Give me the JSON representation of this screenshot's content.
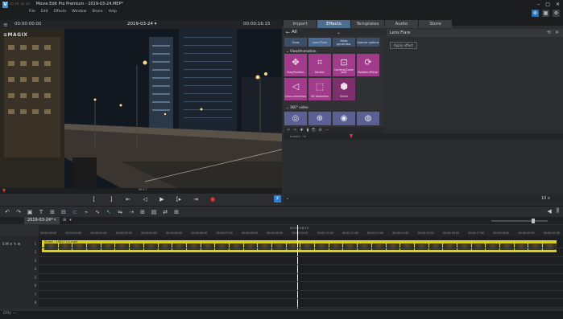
{
  "window": {
    "title": "Movie Edit Pro Premium - 2019-03-24.MEP*",
    "menu": [
      "File",
      "Edit",
      "Effects",
      "Window",
      "Share",
      "Help"
    ],
    "controls": [
      "–",
      "□",
      "✕"
    ]
  },
  "monitor": {
    "timecode_left": "00:00:00:00",
    "date": "2019-03-24 ▾",
    "timecode_right": "00:00:16:15",
    "logo": "≡MAGIX",
    "scrub_time": "06:17"
  },
  "panel_tabs": [
    {
      "label": "Import",
      "active": false
    },
    {
      "label": "Effects",
      "active": true
    },
    {
      "label": "Templates",
      "active": false
    },
    {
      "label": "Audio",
      "active": false
    },
    {
      "label": "Store",
      "active": false
    }
  ],
  "effects": {
    "category": "All",
    "category_tiles": [
      "Glow",
      "Lens Flare",
      "Mask generator",
      "Special options"
    ],
    "section_title": "View/Animation",
    "items": [
      {
        "label": "Size/Position",
        "icon": "move-icon",
        "glyph": "✥"
      },
      {
        "label": "Section",
        "icon": "crop-icon",
        "glyph": "⌗"
      },
      {
        "label": "Camera/Zoom shot",
        "icon": "camera-zoom-icon",
        "glyph": "⊡"
      },
      {
        "label": "Rotation/Mirror",
        "icon": "rotate-icon",
        "glyph": "⟳"
      },
      {
        "label": "Lens correction",
        "icon": "lens-icon",
        "glyph": "◁"
      },
      {
        "label": "3D distortion",
        "icon": "distortion-icon",
        "glyph": "⬚"
      },
      {
        "label": "Shine",
        "icon": "hexagon-icon",
        "glyph": "⬢"
      }
    ],
    "section2_title": "360° video",
    "items_360": [
      {
        "icon": "sphere-icon",
        "glyph": "◎"
      },
      {
        "icon": "globe-icon",
        "glyph": "⊕"
      },
      {
        "icon": "target-icon",
        "glyph": "◉"
      },
      {
        "icon": "orbit-icon",
        "glyph": "◍"
      }
    ],
    "tools": [
      "⇦",
      "⇨",
      "✚",
      "▮",
      "⎘",
      "⊘",
      "⋯"
    ]
  },
  "properties": {
    "title": "Lens Flare",
    "apply_label": "Apply effect",
    "mini_label": "Inaktiv  ·  fx"
  },
  "lower_right": {
    "zoom": "10 s",
    "chevron": "⌄"
  },
  "transport": [
    "[",
    "]",
    "⇤",
    "◁",
    "▶",
    "[▸",
    "⇥",
    "●"
  ],
  "timeline_toolbar": [
    "↶",
    "↷",
    "▣",
    "T",
    "⊞",
    "⊟",
    "⊂",
    "⌁",
    "∿",
    "↖",
    "⇋",
    "⇢",
    "⊞",
    "▤",
    "⇄",
    "⊞"
  ],
  "project": {
    "tab": "2019-03-24*",
    "close": "✕",
    "ruler_center": "00:00:16:15",
    "ruler_ticks": [
      "00:00:00:00",
      "00:00:01:00",
      "00:00:02:00",
      "00:00:03:00",
      "00:00:04:00",
      "00:00:05:00",
      "00:00:06:00",
      "00:00:07:00",
      "00:00:08:00",
      "00:00:09:00",
      "00:00:10:00",
      "00:00:11:00",
      "00:00:12:00",
      "00:00:13:00",
      "00:00:14:00",
      "00:00:15:00",
      "00:00:16:00",
      "00:00:17:00",
      "00:00:18:00",
      "00:00:19:00",
      "00:00:20:00"
    ],
    "clip_label": "Street - 19627 (1).mp4",
    "tracks": [
      {
        "label": "S M ≋ ✎ ⊕",
        "num": "1"
      },
      {
        "label": "",
        "num": "2"
      },
      {
        "label": "",
        "num": "3"
      },
      {
        "label": "",
        "num": "4"
      },
      {
        "label": "",
        "num": "5"
      },
      {
        "label": "",
        "num": "6"
      },
      {
        "label": "",
        "num": "7"
      },
      {
        "label": "",
        "num": "8"
      }
    ]
  },
  "status": {
    "cpu": "CPU: —"
  }
}
